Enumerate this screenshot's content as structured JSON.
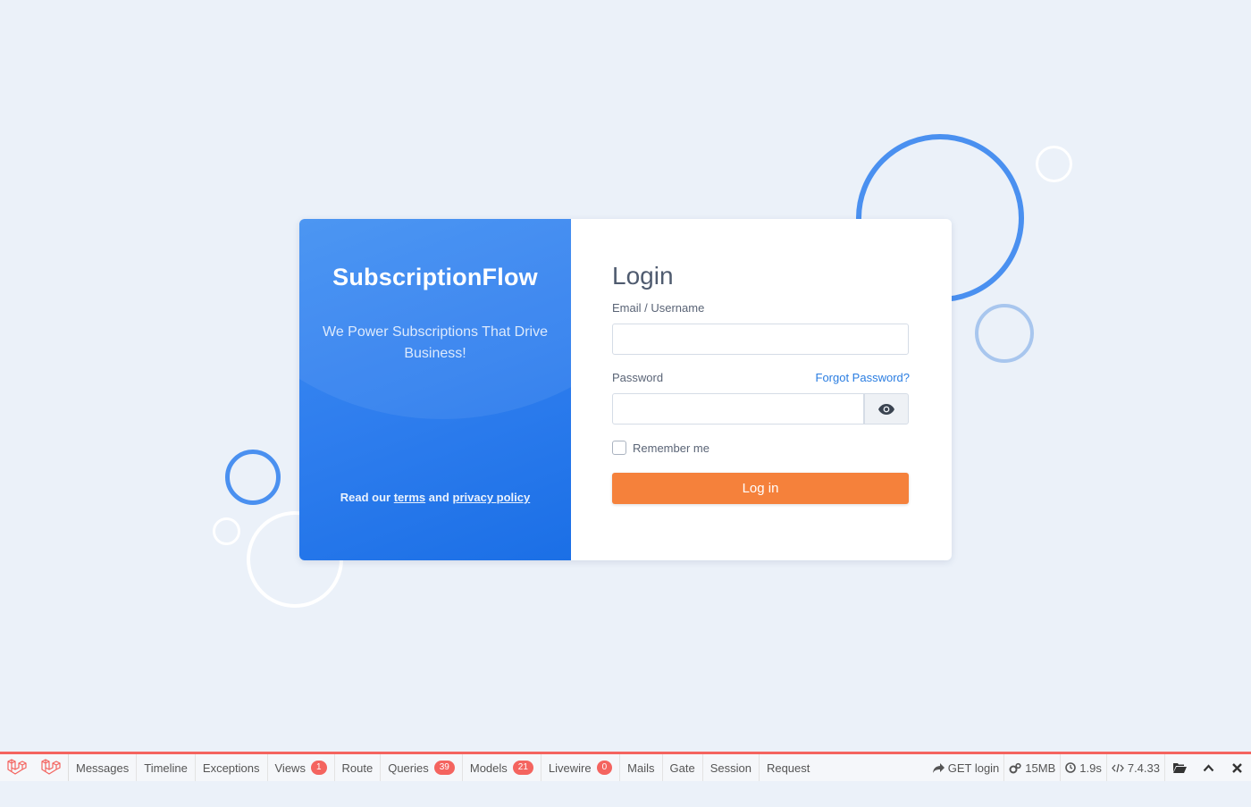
{
  "brand": {
    "name": "SubscriptionFlow",
    "tagline": "We Power Subscriptions That Drive Business!",
    "legal_prefix": "Read our",
    "terms_link": "terms",
    "legal_and": "and",
    "privacy_link": "privacy policy"
  },
  "login": {
    "title": "Login",
    "email_label": "Email / Username",
    "email_value": "",
    "password_label": "Password",
    "password_value": "",
    "forgot_link": "Forgot Password?",
    "remember_label": "Remember me",
    "remember_checked": false,
    "submit_label": "Log in"
  },
  "colors": {
    "background": "#ebf1f9",
    "brand_blue": "#2f7eee",
    "accent_orange": "#f5813b",
    "link_blue": "#2a7de1",
    "debugbar_red": "#f4645f"
  },
  "debugbar": {
    "tabs": [
      {
        "label": "Messages",
        "badge": ""
      },
      {
        "label": "Timeline",
        "badge": ""
      },
      {
        "label": "Exceptions",
        "badge": ""
      },
      {
        "label": "Views",
        "badge": "1"
      },
      {
        "label": "Route",
        "badge": ""
      },
      {
        "label": "Queries",
        "badge": "39"
      },
      {
        "label": "Models",
        "badge": "21"
      },
      {
        "label": "Livewire",
        "badge": "0"
      },
      {
        "label": "Mails",
        "badge": ""
      },
      {
        "label": "Gate",
        "badge": ""
      },
      {
        "label": "Session",
        "badge": ""
      },
      {
        "label": "Request",
        "badge": ""
      }
    ],
    "request": "GET login",
    "memory": "15MB",
    "time": "1.9s",
    "php_version": "7.4.33",
    "icons": {
      "request": "share-arrow-icon",
      "memory": "cogs-icon",
      "time": "clock-icon",
      "php": "code-icon",
      "open": "folder-open-icon",
      "maximize": "chevron-up-icon",
      "close": "close-icon"
    }
  }
}
